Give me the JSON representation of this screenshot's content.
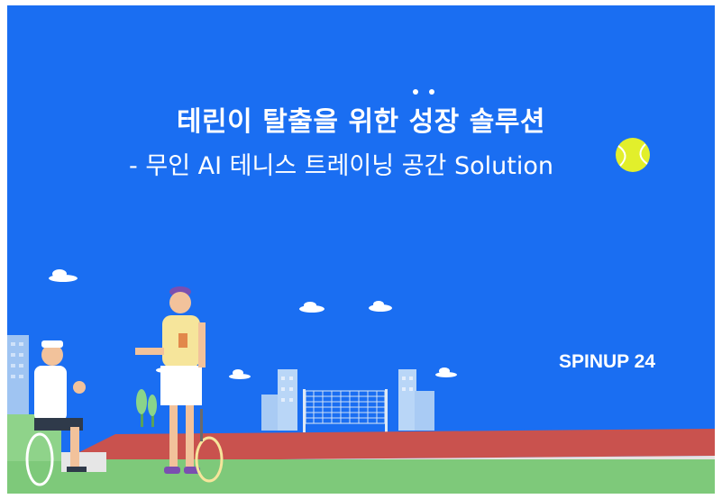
{
  "slide": {
    "title_line1": "테린이 탈출을 위한 성장 솔루션",
    "title_line2": "- 무인 AI 테니스 트레이닝 공간 Solution",
    "brand": "SPINUP 24"
  },
  "icons": [
    "tennis-ball-icon",
    "cloud-icon",
    "building-icon",
    "tennis-net-icon",
    "tennis-racket-icon",
    "player-illustration",
    "tree-icon"
  ],
  "colors": {
    "background": "#1a6ef2",
    "court_track": "#c9524e",
    "grass": "#7ec97a",
    "ball": "#e2ef2b",
    "text": "#ffffff"
  }
}
